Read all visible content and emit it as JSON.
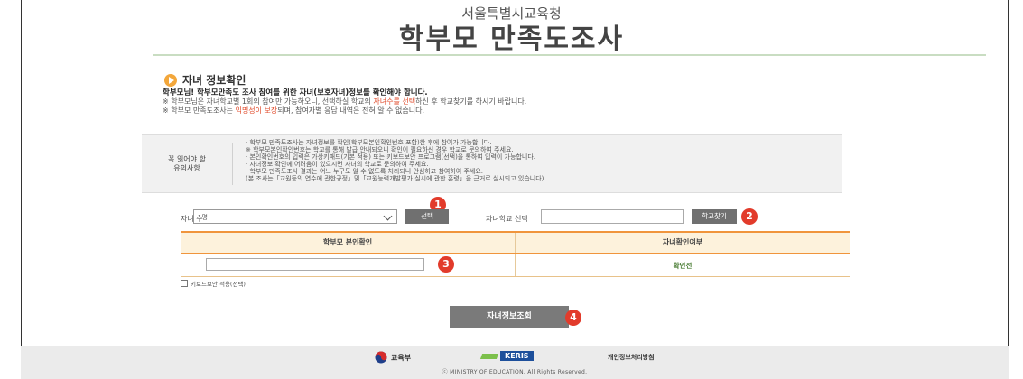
{
  "header": {
    "org": "서울특별시교육청",
    "title": "학부모 만족도조사"
  },
  "section": {
    "title": "자녀 정보확인",
    "intro_bold": "학부모님! 학부모만족도 조사 참여를 위한 자녀(보호자녀)정보를 확인해야 합니다.",
    "note1_pre": "※ 학부모님은 자녀학교별 1회의 참여만 가능하오니, 선택하실 학교의 ",
    "note1_hl": "자녀수를 선택",
    "note1_post": "하신 후 학교찾기를 하시기 바랍니다.",
    "note2_pre": "※ 학부모 만족도조사는 ",
    "note2_hl": "익명성이 보장",
    "note2_post": "되며, 참여자별 응답 내역은 전혀 알 수 없습니다."
  },
  "notice": {
    "title_line1": "꼭 읽어야 할",
    "title_line2": "유의사항",
    "items": [
      "· 학부모 만족도조사는 자녀정보를 확인(학부모본인확인번호 포함)한 후에 참여가 가능합니다.",
      "  ※ 학부모본인확인번호는 학교를 통해 발급 안내되오니 확인이 필요하신 경우 학교로 문의하여 주세요.",
      "· 본인확인번호의 입력은 가상키패드(기본 적용) 또는 키보드보안 프로그램(선택)을 통하여 입력이 가능합니다.",
      "· 자녀정보 확인에 어려움이 있으시면 자녀의 학교로 문의하여 주세요.",
      "· 학부모 만족도조사 결과는 어느 누구도 알 수 없도록 처리되니 안심하고 참여하여 주세요.",
      "  (본 조사는「교원등의 연수에 관한규정」및「교원능력개발평가 실시에 관한 훈령」을 근거로 실시되고 있습니다)"
    ]
  },
  "form": {
    "child_count_label": "자녀 수",
    "child_count_value": "1명",
    "select_button": "선택",
    "school_label": "자녀학교 선택",
    "school_value": "",
    "find_school_button": "학교찾기",
    "badges": [
      "1",
      "2",
      "3",
      "4"
    ],
    "table_headers": [
      "학부모 본인확인",
      "자녀확인여부"
    ],
    "id_value": "",
    "status": "확인전",
    "keyboard_security": "키보드보안 적용(선택)",
    "submit": "자녀정보조회"
  },
  "footer": {
    "ministry": "교육부",
    "keris": "KERIS",
    "privacy": "개인정보처리방침",
    "copyright": "ⓒ MINISTRY OF EDUCATION. All Rights Reserved."
  },
  "colors": {
    "accent_orange": "#f0953c",
    "badge_red": "#e23b2b",
    "highlight": "#e04a2a",
    "status_green": "#4a7d34"
  }
}
